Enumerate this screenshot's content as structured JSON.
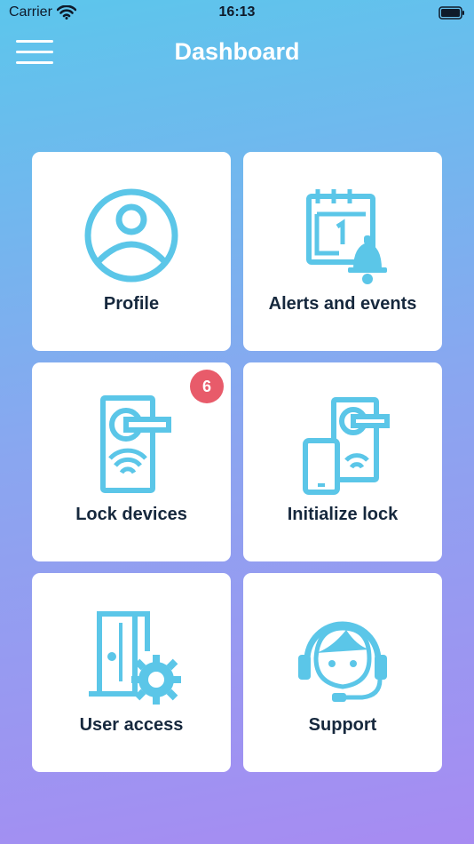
{
  "status_bar": {
    "carrier": "Carrier",
    "time": "16:13"
  },
  "header": {
    "title": "Dashboard"
  },
  "tiles": [
    {
      "label": "Profile",
      "icon": "profile-icon"
    },
    {
      "label": "Alerts and events",
      "icon": "calendar-bell-icon"
    },
    {
      "label": "Lock devices",
      "icon": "door-lock-icon",
      "badge": "6"
    },
    {
      "label": "Initialize lock",
      "icon": "phone-lock-icon"
    },
    {
      "label": "User access",
      "icon": "door-gear-icon"
    },
    {
      "label": "Support",
      "icon": "headset-icon"
    }
  ],
  "colors": {
    "accent": "#5bc6e8",
    "badge": "#e85b6a",
    "label": "#16283d"
  }
}
